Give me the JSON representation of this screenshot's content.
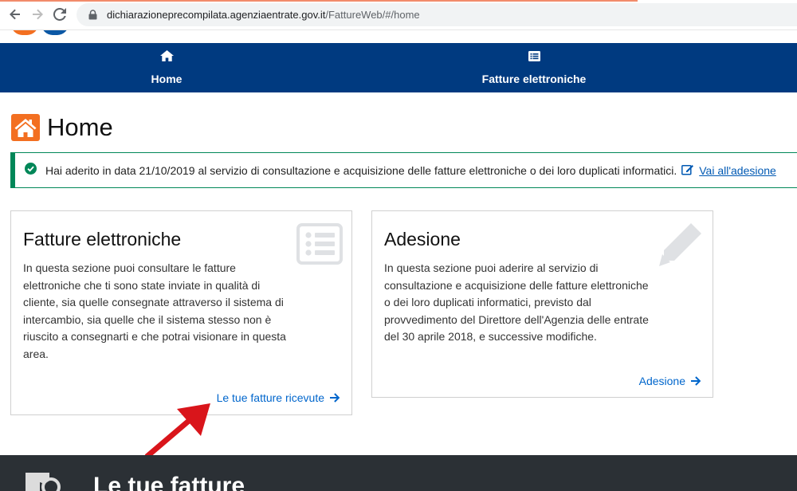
{
  "browser": {
    "url_domain": "dichiarazioneprecompilata.agenziaentrate.gov.it",
    "url_path": "/FattureWeb/#/home"
  },
  "nav": {
    "items": [
      {
        "label": "Home",
        "icon": "home-icon"
      },
      {
        "label": "Fatture elettroniche",
        "icon": "list-icon"
      }
    ],
    "background": "#003a80"
  },
  "page": {
    "title": "Home",
    "title_icon_color": "#f36f21"
  },
  "alert": {
    "text": "Hai aderito in data 21/10/2019 al servizio di consultazione e acquisizione delle fatture elettroniche o dei loro duplicati informatici.",
    "link_label": "Vai all'adesione",
    "color": "#008758"
  },
  "cards": [
    {
      "title": "Fatture elettroniche",
      "body": "In questa sezione puoi consultare le fatture elettroniche che ti sono state inviate in qualità di cliente, sia quelle consegnate attraverso il sistema di intercambio, sia quelle che il sistema stesso non è riuscito a consegnarti e che potrai visionare in questa area.",
      "link_label": "Le tue fatture ricevute",
      "icon": "list-alt-icon"
    },
    {
      "title": "Adesione",
      "body": "In questa sezione puoi aderire al servizio di consultazione e acquisizione delle fatture elettroniche o dei loro duplicati informatici, previsto dal provvedimento del Direttore dell'Agenzia delle entrate del 30 aprile 2018, e successive modifiche.",
      "link_label": "Adesione",
      "icon": "pencil-icon"
    }
  ],
  "section": {
    "title": "Le tue fatture"
  },
  "colors": {
    "link": "#0066cc",
    "annotation_arrow": "#d9151b",
    "dark_section": "#2b3035"
  }
}
